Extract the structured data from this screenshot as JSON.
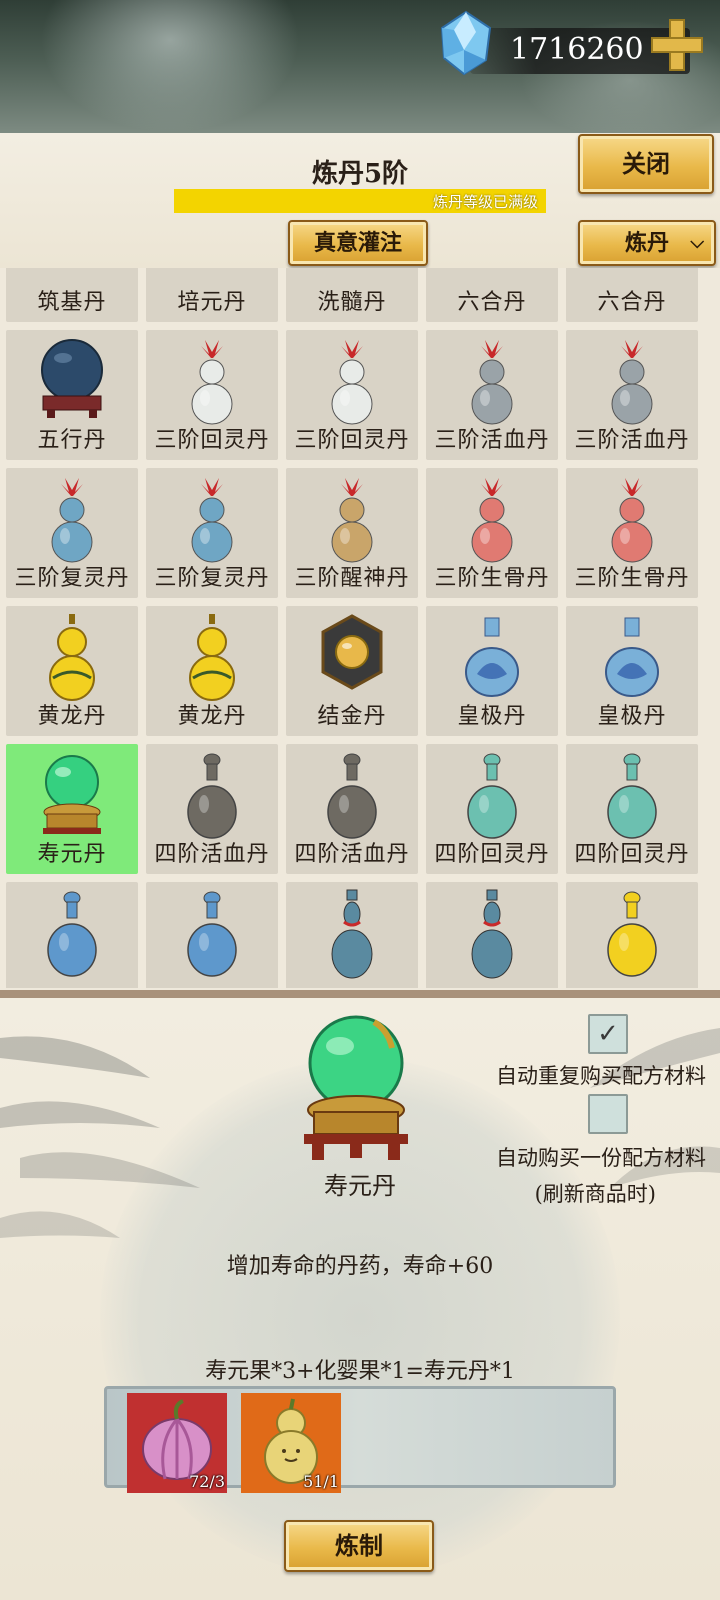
{
  "currency": {
    "amount": "1716260"
  },
  "header": {
    "title": "炼丹5阶",
    "progress_text": "炼丹等级已满级",
    "progress_fraction": 1.0,
    "close_label": "关闭",
    "infuse_label": "真意灌注",
    "dropdown_value": "炼丹"
  },
  "grid": {
    "items": [
      {
        "name": "筑基丹",
        "icon": "pedestal-pill-icon",
        "color": "#6b3a3a"
      },
      {
        "name": "培元丹",
        "icon": "pedestal-pill-icon",
        "color": "#d9a020"
      },
      {
        "name": "洗髓丹",
        "icon": "pedestal-pill-icon",
        "color": "#7a3030"
      },
      {
        "name": "六合丹",
        "icon": "blue-white-vase-icon",
        "color": "#3a5fb0"
      },
      {
        "name": "六合丹",
        "icon": "blue-white-vase-icon",
        "color": "#3a5fb0"
      },
      {
        "name": "五行丹",
        "icon": "orb-pedestal-icon",
        "color": "#2c4a6a"
      },
      {
        "name": "三阶回灵丹",
        "icon": "gourd-icon",
        "color": "#e8ebe8"
      },
      {
        "name": "三阶回灵丹",
        "icon": "gourd-icon",
        "color": "#e8ebe8"
      },
      {
        "name": "三阶活血丹",
        "icon": "gourd-icon",
        "color": "#9aa3a8"
      },
      {
        "name": "三阶活血丹",
        "icon": "gourd-icon",
        "color": "#9aa3a8"
      },
      {
        "name": "三阶复灵丹",
        "icon": "gourd-icon",
        "color": "#6fa6c4"
      },
      {
        "name": "三阶复灵丹",
        "icon": "gourd-icon",
        "color": "#6fa6c4"
      },
      {
        "name": "三阶醒神丹",
        "icon": "gourd-icon",
        "color": "#c9a56a"
      },
      {
        "name": "三阶生骨丹",
        "icon": "gourd-icon",
        "color": "#e07a72"
      },
      {
        "name": "三阶生骨丹",
        "icon": "gourd-icon",
        "color": "#e07a72"
      },
      {
        "name": "黄龙丹",
        "icon": "yellow-gourd-icon",
        "color": "#f2d020"
      },
      {
        "name": "黄龙丹",
        "icon": "yellow-gourd-icon",
        "color": "#f2d020"
      },
      {
        "name": "结金丹",
        "icon": "gold-pearl-box-icon",
        "color": "#e8b84a"
      },
      {
        "name": "皇极丹",
        "icon": "lotus-vase-icon",
        "color": "#7ab0d8"
      },
      {
        "name": "皇极丹",
        "icon": "lotus-vase-icon",
        "color": "#7ab0d8"
      },
      {
        "name": "寿元丹",
        "icon": "jade-orb-icon",
        "color": "#35d080"
      },
      {
        "name": "四阶活血丹",
        "icon": "flask-icon",
        "color": "#6e6a62"
      },
      {
        "name": "四阶活血丹",
        "icon": "flask-icon",
        "color": "#6e6a62"
      },
      {
        "name": "四阶回灵丹",
        "icon": "flask-icon",
        "color": "#6cc0b0"
      },
      {
        "name": "四阶回灵丹",
        "icon": "flask-icon",
        "color": "#6cc0b0"
      },
      {
        "name": "",
        "icon": "flask-icon",
        "color": "#5e98cc"
      },
      {
        "name": "",
        "icon": "flask-icon",
        "color": "#5e98cc"
      },
      {
        "name": "",
        "icon": "slim-vase-icon",
        "color": "#5a8aa0"
      },
      {
        "name": "",
        "icon": "slim-vase-icon",
        "color": "#5a8aa0"
      },
      {
        "name": "",
        "icon": "flask-icon",
        "color": "#f2d020"
      }
    ],
    "selected_index": 20
  },
  "detail": {
    "item_name": "寿元丹",
    "description": "增加寿命的丹药，寿命+60",
    "recipe": "寿元果*3+化婴果*1=寿元丹*1",
    "auto_repeat_label": "自动重复购买配方材料",
    "auto_repeat_checked": true,
    "auto_once_label_1": "自动购买一份配方材料",
    "auto_once_label_2": "(刷新商品时)",
    "auto_once_checked": false,
    "materials": [
      {
        "icon": "longevity-fruit-icon",
        "qty": "72/3",
        "bg": "#c03030"
      },
      {
        "icon": "gourd-fruit-icon",
        "qty": "51/1",
        "bg": "#e06a18"
      }
    ],
    "craft_label": "炼制"
  }
}
